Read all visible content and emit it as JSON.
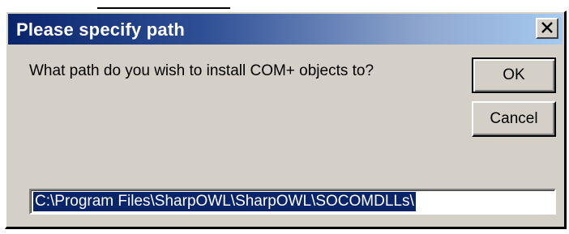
{
  "window": {
    "title": "Please specify path",
    "close_icon": "close-icon"
  },
  "dialog": {
    "prompt": "What path do you wish to install COM+ objects to?",
    "ok_label": "OK",
    "cancel_label": "Cancel",
    "path_value": "C:\\Program Files\\SharpOWL\\SharpOWL\\SOCOMDLLs\\"
  },
  "colors": {
    "titlebar_start": "#0a246a",
    "titlebar_end": "#a6caf0",
    "dialog_face": "#d4d0c8",
    "selection": "#0a246a"
  }
}
